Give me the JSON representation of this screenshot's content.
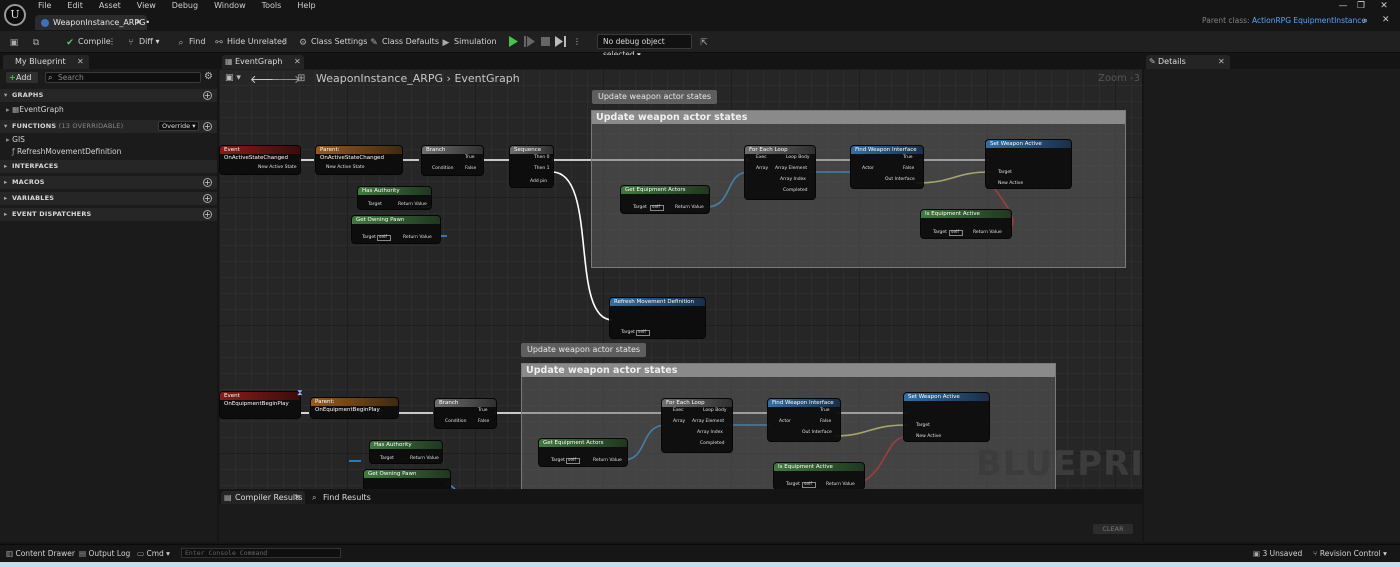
{
  "menu": [
    "File",
    "Edit",
    "Asset",
    "View",
    "Debug",
    "Window",
    "Tools",
    "Help"
  ],
  "document_tab": {
    "label": "WeaponInstance_ARPG•"
  },
  "parent_class": {
    "label": "Parent class:",
    "value": "ActionRPG EquipmentInstance"
  },
  "toolbar": {
    "compile": "Compile",
    "diff": "Diff",
    "find": "Find",
    "hide_unrelated": "Hide Unrelated",
    "class_settings": "Class Settings",
    "class_defaults": "Class Defaults",
    "simulation": "Simulation",
    "debug_object": "No debug object selected"
  },
  "my_blueprint": {
    "tab": "My Blueprint",
    "add": "Add",
    "search_placeholder": "Search",
    "sections": {
      "graphs": "GRAPHS",
      "functions": "FUNCTIONS",
      "functions_count": "(13 OVERRIDABLE)",
      "override": "Override",
      "interfaces": "INTERFACES",
      "macros": "MACROS",
      "variables": "VARIABLES",
      "event_dispatchers": "EVENT DISPATCHERS"
    },
    "graph_items": [
      "EventGraph"
    ],
    "function_items": [
      "GIS",
      "RefreshMovementDefinition"
    ]
  },
  "graph_editor": {
    "tab": "EventGraph",
    "breadcrumb_root": "WeaponInstance_ARPG",
    "breadcrumb_sep": "›",
    "breadcrumb_leaf": "EventGraph",
    "zoom": "Zoom -3",
    "watermark": "BLUEPRINT",
    "comment_top": "Update weapon actor states",
    "comment_bottom": "Update weapon actor states",
    "nodes": {
      "event_active": "Event OnActiveStateChanged",
      "parent_active": "Parent: OnActiveStateChanged",
      "branch": "Branch",
      "sequence": "Sequence",
      "for_each": "For Each Loop",
      "find_weapon": "Find Weapon Interface",
      "set_weapon_active": "Set Weapon Active",
      "get_equipment_actors": "Get Equipment Actors",
      "is_equipment_active": "Is Equipment Active",
      "has_authority": "Has Authority",
      "get_owning_pawn": "Get Owning Pawn",
      "refresh_movement": "Refresh Movement Definition",
      "event_begin": "Event OnEquipmentBeginPlay",
      "parent_begin": "Parent: OnEquipmentBeginPlay"
    },
    "pins": {
      "new_active_state": "New Active State",
      "condition": "Condition",
      "true": "True",
      "false": "False",
      "then0": "Then 0",
      "then1": "Then 1",
      "add_pin": "Add pin",
      "exec": "Exec",
      "array": "Array",
      "loop_body": "Loop Body",
      "array_element": "Array Element",
      "array_index": "Array Index",
      "completed": "Completed",
      "actor": "Actor",
      "out_interface": "Out Interface",
      "target": "Target",
      "new_active": "New Active",
      "return_value": "Return Value",
      "self": "self"
    }
  },
  "details": {
    "tab": "Details"
  },
  "bottom": {
    "compiler_results": "Compiler Results",
    "find_results": "Find Results",
    "clear": "CLEAR"
  },
  "statusbar": {
    "content_drawer": "Content Drawer",
    "output_log": "Output Log",
    "cmd": "Cmd",
    "console_placeholder": "Enter Console Command",
    "unsaved": "3 Unsaved",
    "revision_control": "Revision Control"
  }
}
